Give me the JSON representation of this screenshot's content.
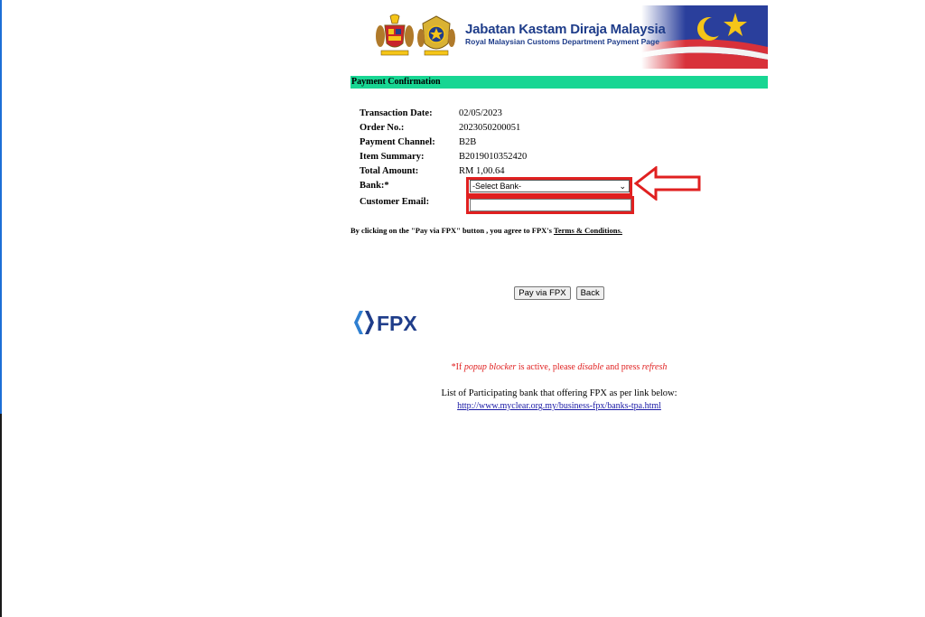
{
  "header": {
    "title": "Jabatan Kastam Diraja Malaysia",
    "subtitle": "Royal Malaysian Customs Department Payment Page"
  },
  "section_title": "Payment Confirmation",
  "details": {
    "transaction_date_label": "Transaction Date:",
    "transaction_date": "02/05/2023",
    "order_no_label": "Order No.:",
    "order_no": "2023050200051",
    "payment_channel_label": "Payment Channel:",
    "payment_channel": "B2B",
    "item_summary_label": "Item Summary:",
    "item_summary": "B2019010352420",
    "total_amount_label": "Total Amount:",
    "total_amount": "RM 1,00.64",
    "bank_label": "Bank:*",
    "bank_selected": "-Select Bank-",
    "email_label": "Customer Email:",
    "email_value": ""
  },
  "agreement": {
    "prefix": "By clicking on the \"Pay via FPX\" button , you agree to FPX's ",
    "link": "Terms & Conditions."
  },
  "buttons": {
    "pay": "Pay via FPX",
    "back": "Back"
  },
  "fpx_logo": "FPX",
  "popup_note": {
    "prefix": "*If ",
    "italic1": "popup blocker",
    "mid": " is active, please ",
    "italic2": "disable",
    "mid2": " and press ",
    "italic3": "refresh"
  },
  "bank_list": {
    "text": "List of Participating bank that offering FPX as per link below:",
    "link": "http://www.myclear.org.my/business-fpx/banks-tpa.html"
  },
  "colors": {
    "section_bar": "#18d693",
    "highlight": "#e02020",
    "title_blue": "#1f3d8a"
  }
}
